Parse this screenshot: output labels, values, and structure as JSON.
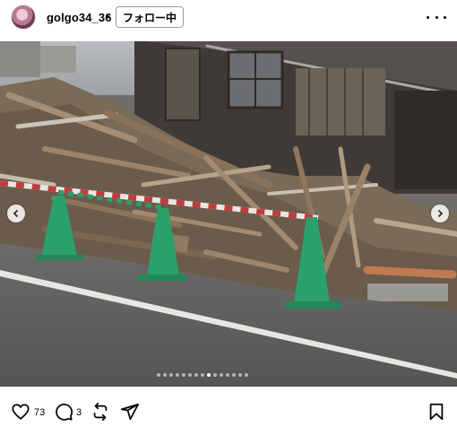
{
  "post": {
    "username": "golgo34_36",
    "separator": "•",
    "follow_label": "フォロー中",
    "more_icon": "more-horizontal-icon"
  },
  "carousel": {
    "slide_count": 15,
    "active_index": 8,
    "prev_icon": "chevron-left-icon",
    "next_icon": "chevron-right-icon"
  },
  "actions": {
    "like_icon": "heart-icon",
    "like_count": "73",
    "comment_icon": "comment-icon",
    "comment_count": "3",
    "repost_icon": "repost-icon",
    "share_icon": "send-icon",
    "save_icon": "bookmark-icon"
  },
  "colors": {
    "cone": "#2aa06a",
    "barrier_red": "#c23b3b",
    "road": "#5e5e5c",
    "debris": "#7a6450"
  }
}
